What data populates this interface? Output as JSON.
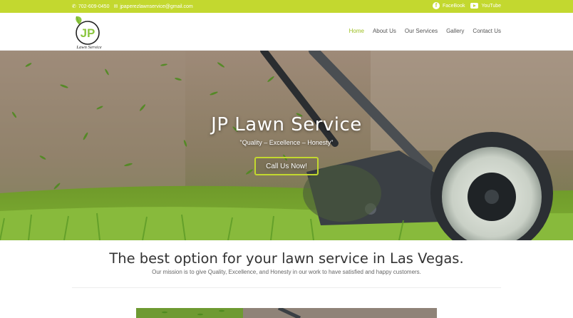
{
  "topbar": {
    "phone": "702-609-0450",
    "email": "jpaperezlawnservice@gmail.com",
    "facebook_label": "FaceBook",
    "youtube_label": "YouTube"
  },
  "logo": {
    "monogram": "JP",
    "tagline": "Lawn Service"
  },
  "nav": {
    "items": [
      "Home",
      "About Us",
      "Our Services",
      "Gallery",
      "Contact Us"
    ],
    "active": "Home"
  },
  "hero": {
    "title": "JP Lawn Service",
    "subtitle": "\"Quality – Excellence – Honesty\"",
    "cta_label": "Call Us Now!"
  },
  "content": {
    "headline": "The best option for your lawn service in Las Vegas.",
    "mission": "Our mission is to give Quality, Excellence, and Honesty in our work to have satisfied and happy customers."
  },
  "colors": {
    "accent": "#c3d82f",
    "nav_active": "#9cbf1f",
    "text_dark": "#333333",
    "text_body": "#666666"
  }
}
